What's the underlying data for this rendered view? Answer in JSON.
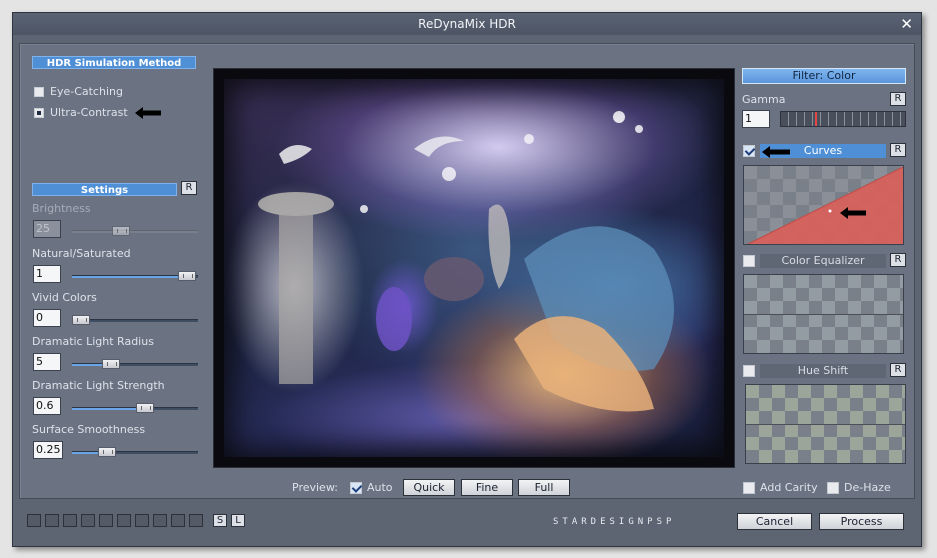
{
  "window": {
    "title": "ReDynaMix HDR"
  },
  "method": {
    "header": "HDR Simulation Method",
    "options": [
      {
        "label": "Eye-Catching",
        "selected": false
      },
      {
        "label": "Ultra-Contrast",
        "selected": true
      }
    ]
  },
  "settings": {
    "header": "Settings",
    "reset_label": "R",
    "brightness": {
      "label": "Brightness",
      "value": "25",
      "level": 0.35,
      "disabled": true
    },
    "natural_saturated": {
      "label": "Natural/Saturated",
      "value": "1",
      "level": 1.0
    },
    "vivid_colors": {
      "label": "Vivid Colors",
      "value": "0",
      "level": 0.0
    },
    "dramatic_light_radius": {
      "label": "Dramatic Light Radius",
      "value": "5",
      "level": 0.25
    },
    "dramatic_light_strength": {
      "label": "Dramatic Light Strength",
      "value": "0.6",
      "level": 0.6
    },
    "surface_smoothness": {
      "label": "Surface Smoothness",
      "value": "0.25",
      "level": 0.25
    }
  },
  "preview": {
    "label": "Preview:",
    "auto_label": "Auto",
    "auto_checked": true,
    "buttons": [
      "Quick",
      "Fine",
      "Full"
    ]
  },
  "filter": {
    "header": "Filter: Color",
    "gamma": {
      "label": "Gamma",
      "value": "1",
      "reset_label": "R"
    },
    "curves": {
      "label": "Curves",
      "checked": true,
      "reset_label": "R"
    },
    "color_equalizer": {
      "label": "Color Equalizer",
      "checked": false,
      "reset_label": "R"
    },
    "hue_shift": {
      "label": "Hue Shift",
      "checked": false,
      "reset_label": "R"
    },
    "add_clarity": {
      "label": "Add Carity",
      "checked": false
    },
    "de_haze": {
      "label": "De-Haze",
      "checked": false
    }
  },
  "footer": {
    "slot_count": 10,
    "s_label": "S",
    "l_label": "L",
    "logo_text": "STARDESIGNPSP",
    "cancel_label": "Cancel",
    "process_label": "Process"
  },
  "colors": {
    "accent": "#4e8fd6",
    "curve_fill": "#d9605a",
    "panel": "#6b7382"
  }
}
